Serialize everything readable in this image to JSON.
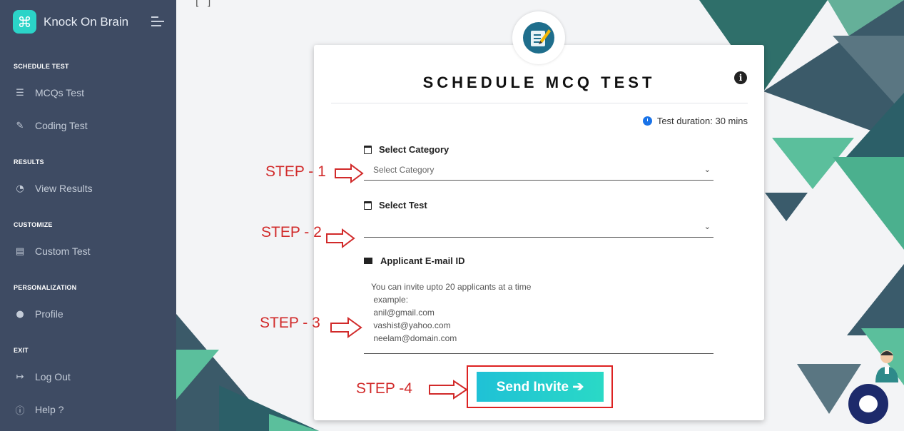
{
  "app": {
    "brand_name": "Knock On Brain",
    "brand_icon": "command-icon"
  },
  "sidebar": {
    "sections": [
      {
        "title": "SCHEDULE TEST"
      },
      {
        "title": "RESULTS"
      },
      {
        "title": "CUSTOMIZE"
      },
      {
        "title": "PERSONALIZATION"
      },
      {
        "title": "EXIT"
      }
    ],
    "items": [
      {
        "label": "MCQs Test",
        "icon": "list-icon"
      },
      {
        "label": "Coding Test",
        "icon": "edit-icon"
      },
      {
        "label": "View Results",
        "icon": "pie-chart-icon"
      },
      {
        "label": "Custom Test",
        "icon": "document-icon"
      },
      {
        "label": "Profile",
        "icon": "user-icon"
      },
      {
        "label": "Log Out",
        "icon": "logout-icon"
      },
      {
        "label": "Help ?",
        "icon": "info-icon"
      }
    ]
  },
  "card": {
    "title": "SCHEDULE MCQ TEST",
    "duration": "Test duration: 30 mins",
    "category_label": "Select Category",
    "category_value": "Select Category",
    "test_label": "Select Test",
    "test_value": "",
    "email_label": "Applicant E-mail ID",
    "email_placeholder_lines": [
      "You can invite upto 20 applicants at a time",
      " example:",
      " anil@gmail.com",
      " vashist@yahoo.com",
      " neelam@domain.com"
    ],
    "send_label": "Send Invite ➔"
  },
  "steps": {
    "step1": "STEP - 1",
    "step2": "STEP - 2",
    "step3": "STEP - 3",
    "step4": "STEP -4"
  },
  "colors": {
    "sidebar_bg": "#3e4b63",
    "brand_accent": "#2bd4c8",
    "button_gradient_start": "#1fc1d6",
    "button_gradient_end": "#2ad9c6",
    "annotation_red": "#d12a2a",
    "chat_button": "#1d2a6b"
  }
}
